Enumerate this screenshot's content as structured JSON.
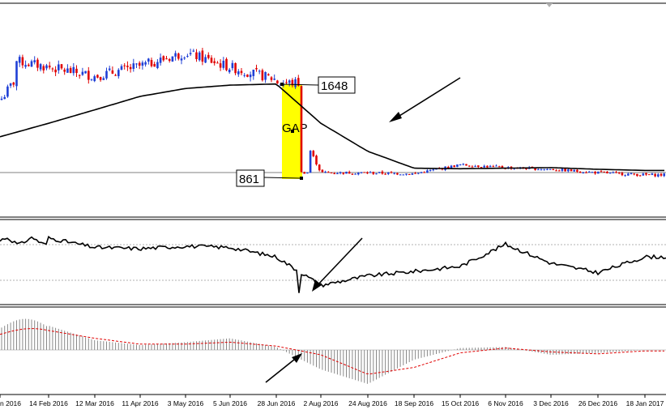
{
  "chart_data": [
    {
      "type": "candlestick",
      "panel": "price",
      "x": [
        "14 Feb 2016",
        "12 Mar 2016",
        "11 Apr 2016",
        "3 May 2016",
        "5 Jun 2016",
        "28 Jun 2016",
        "2 Aug 2016",
        "24 Aug 2016",
        "18 Sep 2016",
        "15 Oct 2016",
        "6 Nov 2016",
        "3 Dec 2016",
        "26 Dec 2016",
        "18 Jan 2017"
      ],
      "closes": [
        1800,
        1720,
        1810,
        1930,
        1800,
        1690,
        861,
        858,
        850,
        930,
        905,
        890,
        860,
        840
      ],
      "moving_average": [
        1300,
        1420,
        1540,
        1610,
        1640,
        1650,
        1300,
        1050,
        900,
        895,
        900,
        905,
        890,
        880
      ],
      "levels": [
        1648,
        861
      ],
      "annotations": [
        "1648",
        "GAP",
        "861"
      ]
    },
    {
      "type": "line",
      "panel": "oscillator",
      "values": [
        0.85,
        0.7,
        0.68,
        0.72,
        0.7,
        0.55,
        0.1,
        0.25,
        0.32,
        0.4,
        0.75,
        0.45,
        0.3,
        0.55
      ]
    },
    {
      "type": "bar",
      "panel": "histogram",
      "values": [
        25,
        10,
        5,
        8,
        12,
        3,
        -20,
        -35,
        -10,
        2,
        3,
        -5,
        -3,
        0
      ],
      "signal": [
        20,
        12,
        6,
        6,
        8,
        4,
        -5,
        -25,
        -18,
        -3,
        2,
        -2,
        -4,
        -1
      ]
    }
  ],
  "xaxis_labels": [
    "n 2016",
    "14 Feb 2016",
    "12 Mar 2016",
    "11 Apr 2016",
    "3 May 2016",
    "5 Jun 2016",
    "28 Jun 2016",
    "2 Aug 2016",
    "24 Aug 2016",
    "18 Sep 2016",
    "15 Oct 2016",
    "6 Nov 2016",
    "3 Dec 2016",
    "26 Dec 2016",
    "18 Jan 2017"
  ],
  "labels": {
    "upper": "1648",
    "lower": "861",
    "gap": "GAP"
  },
  "colors": {
    "bull": "#1f3fd6",
    "bear": "#e00000",
    "highlight": "#ffff00",
    "ma": "#000000",
    "signal": "#e00000",
    "hist": "#888888",
    "dotted": "#b0b0b0"
  }
}
